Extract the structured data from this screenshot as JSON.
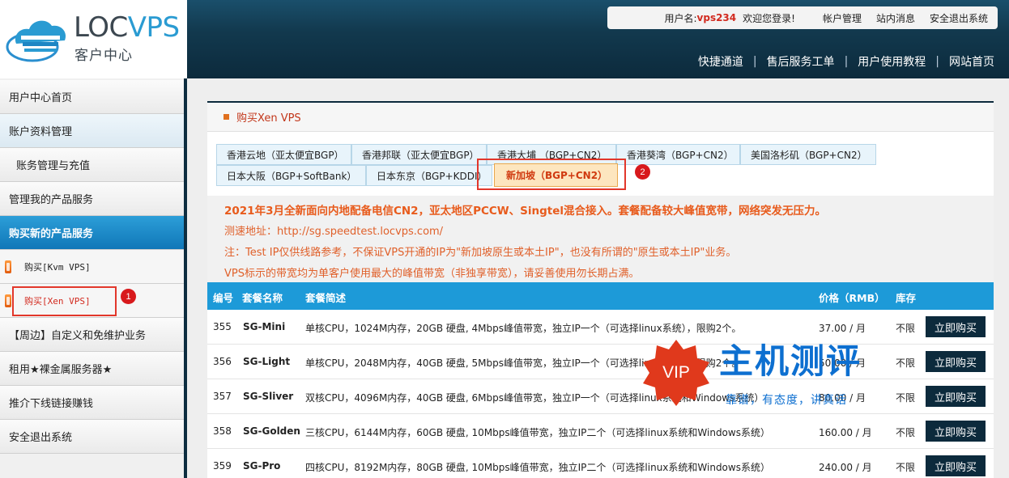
{
  "brand": {
    "name_loc": "LOC",
    "name_vps": "VPS",
    "subtitle": "客户中心"
  },
  "user_box": {
    "username_label": "用户名:",
    "username": "vps234",
    "welcome": "欢迎您登录!",
    "links": [
      "帐户管理",
      "站内消息",
      "安全退出系统"
    ]
  },
  "top_nav": [
    "快捷通道",
    "售后服务工单",
    "用户使用教程",
    "网站首页"
  ],
  "sidebar": {
    "items": [
      "用户中心首页",
      "账户资料管理",
      "账务管理与充值",
      "管理我的产品服务",
      "购买新的产品服务",
      "购买[Kvm VPS]",
      "购买[Xen VPS]",
      "【周边】自定义和免维护业务",
      "租用★裸金属服务器★",
      "推介下线链接赚钱",
      "安全退出系统"
    ]
  },
  "badges": [
    "1",
    "2"
  ],
  "panel": {
    "title": "购买Xen VPS"
  },
  "region_tabs": [
    "香港云地（亚太便宜BGP）",
    "香港邦联（亚太便宜BGP）",
    "香港大埔 （BGP+CN2）",
    "香港葵湾（BGP+CN2）",
    "美国洛杉矶（BGP+CN2）",
    "日本大阪（BGP+SoftBank）",
    "日本东京（BGP+KDDI）",
    "新加坡（BGP+CN2）"
  ],
  "notices": [
    "2021年3月全新面向内地配备电信CN2，亚太地区PCCW、Singtel混合接入。套餐配备较大峰值宽带，网络突发无压力。",
    "测速地址：http://sg.speedtest.locvps.com/",
    "注：Test IP仅供线路参考，不保证VPS开通的IP为\"新加坡原生或本土IP\"，也没有所谓的\"原生或本土IP\"业务。",
    "VPS标示的带宽均为单客户使用最大的峰值带宽（非独享带宽），请妥善使用勿长期占满。"
  ],
  "table": {
    "headers": [
      "编号",
      "套餐名称",
      "套餐简述",
      "价格（RMB）",
      "库存"
    ],
    "buy_label": "立即购买",
    "rows": [
      {
        "id": "355",
        "name": "SG-Mini",
        "desc": "单核CPU，1024M内存，20GB 硬盘, 4Mbps峰值带宽，独立IP一个（可选择linux系统），限购2个。",
        "price": "37.00 / 月",
        "stock": "不限"
      },
      {
        "id": "356",
        "name": "SG-Light",
        "desc": "单核CPU，2048M内存，40GB 硬盘, 5Mbps峰值带宽，独立IP一个（可选择linux系统），限购2个。",
        "price": "50.00 / 月",
        "stock": "不限"
      },
      {
        "id": "357",
        "name": "SG-Sliver",
        "desc": "双核CPU，4096M内存，40GB 硬盘, 6Mbps峰值带宽，独立IP一个（可选择linux系统和Windows系统）",
        "price": "80.00 / 月",
        "stock": "不限"
      },
      {
        "id": "358",
        "name": "SG-Golden",
        "desc": "三核CPU，6144M内存，60GB 硬盘, 10Mbps峰值带宽，独立IP二个（可选择linux系统和Windows系统）",
        "price": "160.00 / 月",
        "stock": "不限"
      },
      {
        "id": "359",
        "name": "SG-Pro",
        "desc": "四核CPU，8192M内存，80GB 硬盘, 10Mbps峰值带宽，独立IP二个（可选择linux系统和Windows系统）",
        "price": "240.00 / 月",
        "stock": "不限"
      }
    ]
  },
  "watermark": {
    "badge": "VIP",
    "title": "主机测评",
    "slogan": "靠谱，有态度，讲真话"
  },
  "colors": {
    "accent_blue": "#1d9ad8",
    "dark_navy": "#0c2a3c",
    "notice_orange": "#e0602a",
    "marker_red": "#e2372b"
  }
}
